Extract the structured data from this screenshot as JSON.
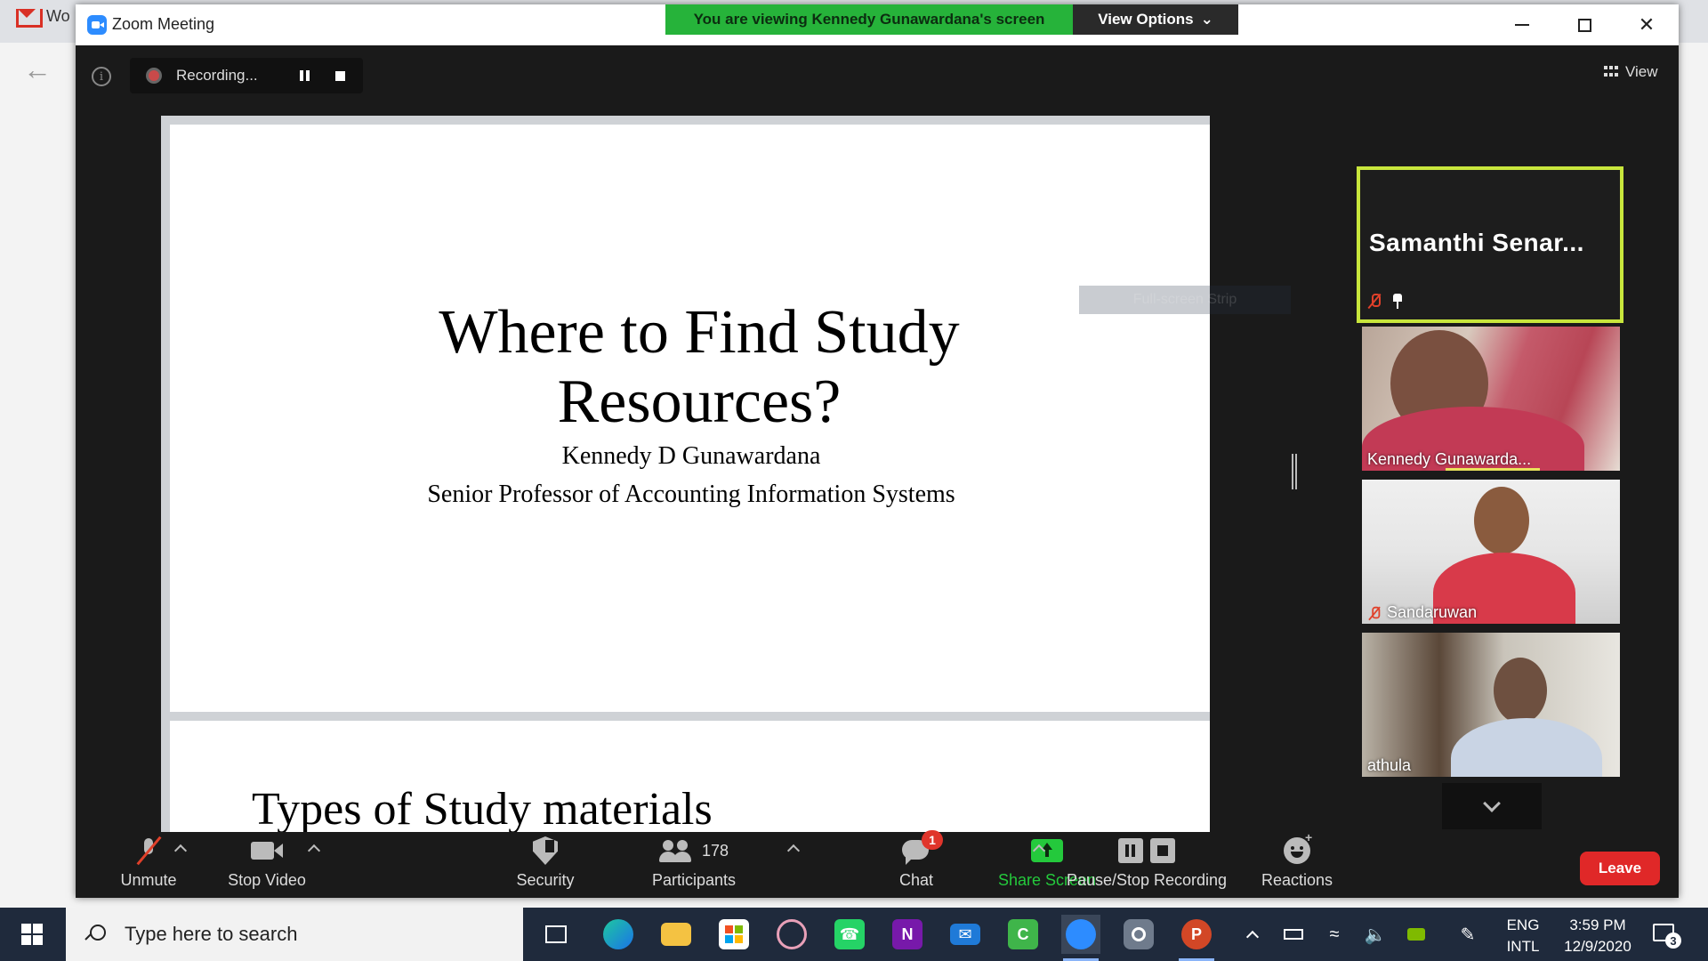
{
  "background": {
    "tab_title": "Wo"
  },
  "window": {
    "title": "Zoom Meeting"
  },
  "share": {
    "banner_text": "You are viewing Kennedy Gunawardana's screen",
    "view_options_label": "View Options"
  },
  "recording": {
    "status_text": "Recording..."
  },
  "view_button_label": "View",
  "slide": {
    "title_line1": "Where to Find  Study",
    "title_line2": "Resources?",
    "author": "Kennedy D Gunawardana",
    "role": "Senior Professor of Accounting Information Systems",
    "next_slide_title": "Types of Study materials"
  },
  "fullscreen_tip": "Full-screen Strip",
  "participants_gallery": {
    "active_speaker": "Samanthi  Senar...",
    "tiles": [
      {
        "name": "Kennedy Gunawarda..."
      },
      {
        "name": "Sandaruwan"
      },
      {
        "name": "athula"
      }
    ]
  },
  "toolbar": {
    "unmute": "Unmute",
    "stop_video": "Stop Video",
    "security": "Security",
    "participants": "Participants",
    "participants_count": "178",
    "chat": "Chat",
    "chat_badge": "1",
    "share_screen": "Share Screen",
    "pause_stop_recording": "Pause/Stop Recording",
    "reactions": "Reactions",
    "leave": "Leave"
  },
  "taskbar": {
    "search_placeholder": "Type here to search",
    "lang_line1": "ENG",
    "lang_line2": "INTL",
    "time": "3:59 PM",
    "date": "12/9/2020",
    "notification_count": "3"
  },
  "colors": {
    "share_banner": "#26b33a",
    "active_speaker_border": "#c8e63c",
    "leave": "#e02828",
    "share_screen_label": "#24c93c"
  }
}
